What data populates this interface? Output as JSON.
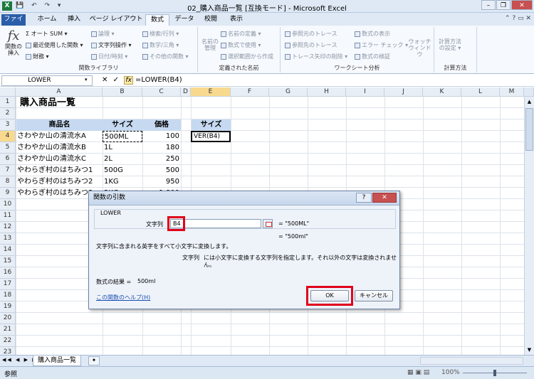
{
  "window": {
    "title": "02_購入商品一覧  [互換モード] - Microsoft Excel",
    "app_icon": "X",
    "min": "–",
    "restore": "❐",
    "close": "✕"
  },
  "ribbon_tabs": [
    "ファイル",
    "ホーム",
    "挿入",
    "ページ レイアウト",
    "数式",
    "データ",
    "校閲",
    "表示"
  ],
  "ribbon": {
    "insert_function": "関数の\n挿入",
    "autosum": "Σ オート SUM ▾",
    "recent": "最近使用した関数 ▾",
    "financial": "財務 ▾",
    "logical": "論理 ▾",
    "text": "文字列操作 ▾",
    "datetime": "日付/時刻 ▾",
    "lookup": "検索/行列 ▾",
    "math": "数学/三角 ▾",
    "more": "その他の関数 ▾",
    "group_library": "関数ライブラリ",
    "name_manager": "名前の\n管理",
    "define_name": "名前の定義 ▾",
    "use_in_formula": "数式で使用 ▾",
    "create_from_sel": "選択範囲から作成",
    "group_names": "定義された名前",
    "trace_prec": "参照元のトレース",
    "trace_dep": "参照先のトレース",
    "remove_arrows": "トレース矢印の削除 ▾",
    "show_formulas": "数式の表示",
    "error_check": "エラー チェック ▾",
    "evaluate": "数式の検証",
    "watch": "ウォッチ\nウィンドウ",
    "group_audit": "ワークシート分析",
    "calc_options": "計算方法\nの設定 ▾",
    "group_calc": "計算方法"
  },
  "formula_bar": {
    "name_box": "LOWER",
    "cancel": "✕",
    "enter": "✓",
    "fx": "fx",
    "formula": "=LOWER(B4)"
  },
  "columns": [
    "A",
    "B",
    "C",
    "D",
    "E",
    "F",
    "G",
    "H",
    "I",
    "J",
    "K",
    "L",
    "M"
  ],
  "rows": [
    "1",
    "2",
    "3",
    "4",
    "5",
    "6",
    "7",
    "8",
    "9",
    "10",
    "11",
    "12",
    "13",
    "14",
    "15",
    "16",
    "17",
    "18",
    "19",
    "20",
    "21",
    "22",
    "23"
  ],
  "sheet": {
    "title": "購入商品一覧",
    "headers": {
      "name": "商品名",
      "size": "サイズ",
      "price": "価格",
      "size2": "サイズ"
    },
    "products": [
      {
        "name": "さわやか山の清流水A",
        "size": "500ML",
        "price": "100"
      },
      {
        "name": "さわやか山の清流水B",
        "size": "1L",
        "price": "180"
      },
      {
        "name": "さわやか山の清流水C",
        "size": "2L",
        "price": "250"
      },
      {
        "name": "やわらぎ村のはちみつ1",
        "size": "500G",
        "price": "500"
      },
      {
        "name": "やわらぎ村のはちみつ2",
        "size": "1KG",
        "price": "950"
      },
      {
        "name": "やわらぎ村のはちみつ3",
        "size": "2KG",
        "price": "1,800"
      }
    ],
    "edit_cell": "VER(B4)"
  },
  "dialog": {
    "title": "関数の引数",
    "help_btn": "?",
    "close_btn": "✕",
    "function_name": "LOWER",
    "arg_label": "文字列",
    "arg_value": "B4",
    "arg_result": "= \"500ML\"",
    "result": "= \"500ml\"",
    "description": "文字列に含まれる英字をすべて小文字に変換します。",
    "arg_desc_label": "文字列",
    "arg_desc": "には小文字に変換する文字列を指定します。それ以外の文字は変換されませ",
    "arg_desc2": "ん。",
    "formula_result_label": "数式の結果 =",
    "formula_result": "500ml",
    "help_link": "この関数のヘルプ(H)",
    "ok": "OK",
    "cancel": "キャンセル"
  },
  "sheet_tabs": {
    "active": "購入商品一覧"
  },
  "status": {
    "mode": "参照",
    "zoom": "100%"
  }
}
